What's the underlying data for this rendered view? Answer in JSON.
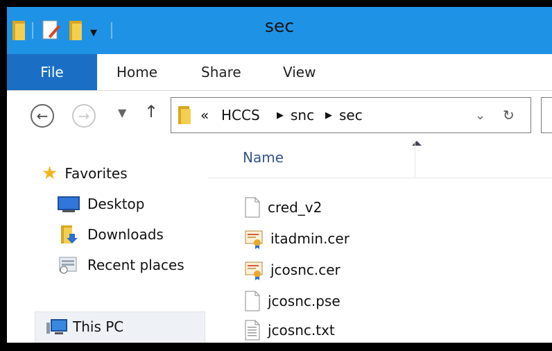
{
  "window": {
    "title": "sec"
  },
  "ribbon": {
    "tabs": [
      "File",
      "Home",
      "Share",
      "View"
    ]
  },
  "address": {
    "overflow": "«",
    "path": [
      "HCCS",
      "snc",
      "sec"
    ]
  },
  "navigation_pane": {
    "favorites_label": "Favorites",
    "items": [
      "Desktop",
      "Downloads",
      "Recent places"
    ],
    "this_pc": "This PC"
  },
  "file_list": {
    "column_name": "Name",
    "sort": "ascending",
    "files": [
      {
        "name": "cred_v2",
        "icon": "blank-file-icon"
      },
      {
        "name": "itadmin.cer",
        "icon": "certificate-icon"
      },
      {
        "name": "jcosnc.cer",
        "icon": "certificate-icon"
      },
      {
        "name": "jcosnc.pse",
        "icon": "blank-file-icon"
      },
      {
        "name": "jcosnc.txt",
        "icon": "text-file-icon"
      }
    ]
  },
  "colors": {
    "titlebar": "#1e93e6",
    "file_tab": "#1a6fc4",
    "column_header_text": "#31558a"
  }
}
